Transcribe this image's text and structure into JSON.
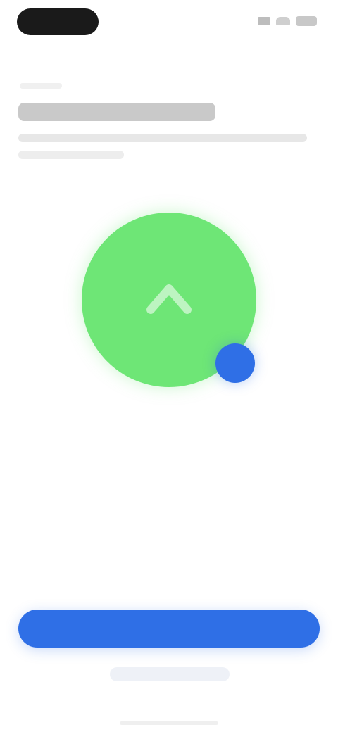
{
  "status_bar": {},
  "header": {},
  "hero": {
    "icon_name": "chevron-up-icon",
    "badge_icon_name": "dot-badge-icon",
    "colors": {
      "circle": "#6ee676",
      "badge": "#2f6fe6"
    }
  },
  "actions": {
    "primary_label": "",
    "secondary_label": ""
  },
  "colors": {
    "accent": "#2f6fe6",
    "background": "#ffffff"
  }
}
